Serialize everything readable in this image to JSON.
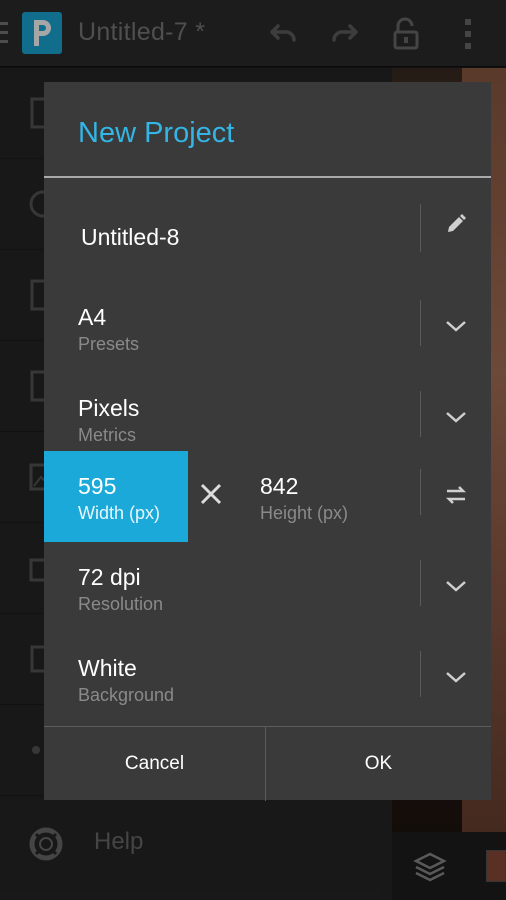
{
  "app": {
    "title": "Untitled-7 *",
    "icons": [
      "menu-icon",
      "app-logo-icon",
      "undo-icon",
      "redo-icon",
      "unlock-icon",
      "overflow-menu-icon"
    ]
  },
  "drawer": {
    "help_label": "Help"
  },
  "dialog": {
    "title": "New Project",
    "project_name": "Untitled-8",
    "preset": {
      "value": "A4",
      "label": "Presets"
    },
    "metrics": {
      "value": "Pixels",
      "label": "Metrics"
    },
    "width": {
      "value": "595",
      "label": "Width (px)"
    },
    "height": {
      "value": "842",
      "label": "Height (px)"
    },
    "resolution": {
      "value": "72 dpi",
      "label": "Resolution"
    },
    "background": {
      "value": "White",
      "label": "Background"
    },
    "cancel_label": "Cancel",
    "ok_label": "OK"
  },
  "colors": {
    "accent": "#33b5e5",
    "selected_fill": "#1aa9d8",
    "dialog_bg": "#3a3a3a"
  }
}
